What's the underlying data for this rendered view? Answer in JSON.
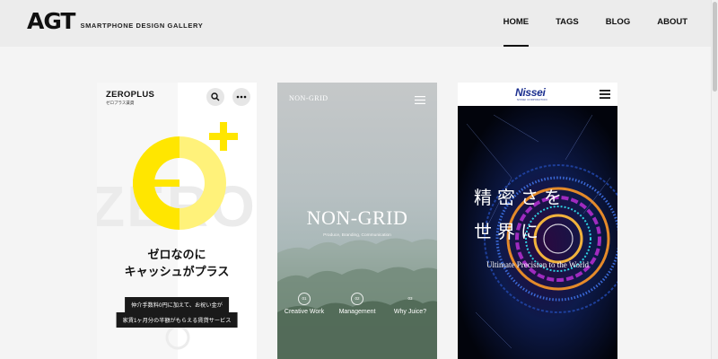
{
  "site": {
    "logo_mark": "AGT",
    "logo_sub": "SMARTPHONE DESIGN GALLERY"
  },
  "nav": [
    {
      "label": "HOME",
      "active": true
    },
    {
      "label": "TAGS",
      "active": false
    },
    {
      "label": "BLOG",
      "active": false
    },
    {
      "label": "ABOUT",
      "active": false
    }
  ],
  "cards": {
    "zeroplus": {
      "name": "ZEROPLUS",
      "sub": "ゼロプラス賃貸",
      "bg_word": "ZERO",
      "headline_1": "ゼロなのに",
      "headline_2": "キャッシュがプラス",
      "tag_1": "仲介手数料0円に加えて、お祝い金が",
      "tag_2": "家賃1ヶ月分の半額がもらえる賃貸サービス",
      "accent": "#ffe600"
    },
    "nongrid": {
      "logo": "NON-GRID",
      "title": "NON-GRID",
      "sub": "Produce, Branding, Communication",
      "links": [
        {
          "num": "01",
          "label": "Creative Work"
        },
        {
          "num": "02",
          "label": "Management"
        },
        {
          "num": "03",
          "label": "Why Juice?"
        }
      ]
    },
    "nissei": {
      "logo": "Nissei",
      "logo_sub": "NISSEI CORPORATION",
      "jp_line_1": "精密さを",
      "jp_line_2": "世界に",
      "en": "Ultimate Precision to the World",
      "brand": "#1b2f8f"
    }
  }
}
